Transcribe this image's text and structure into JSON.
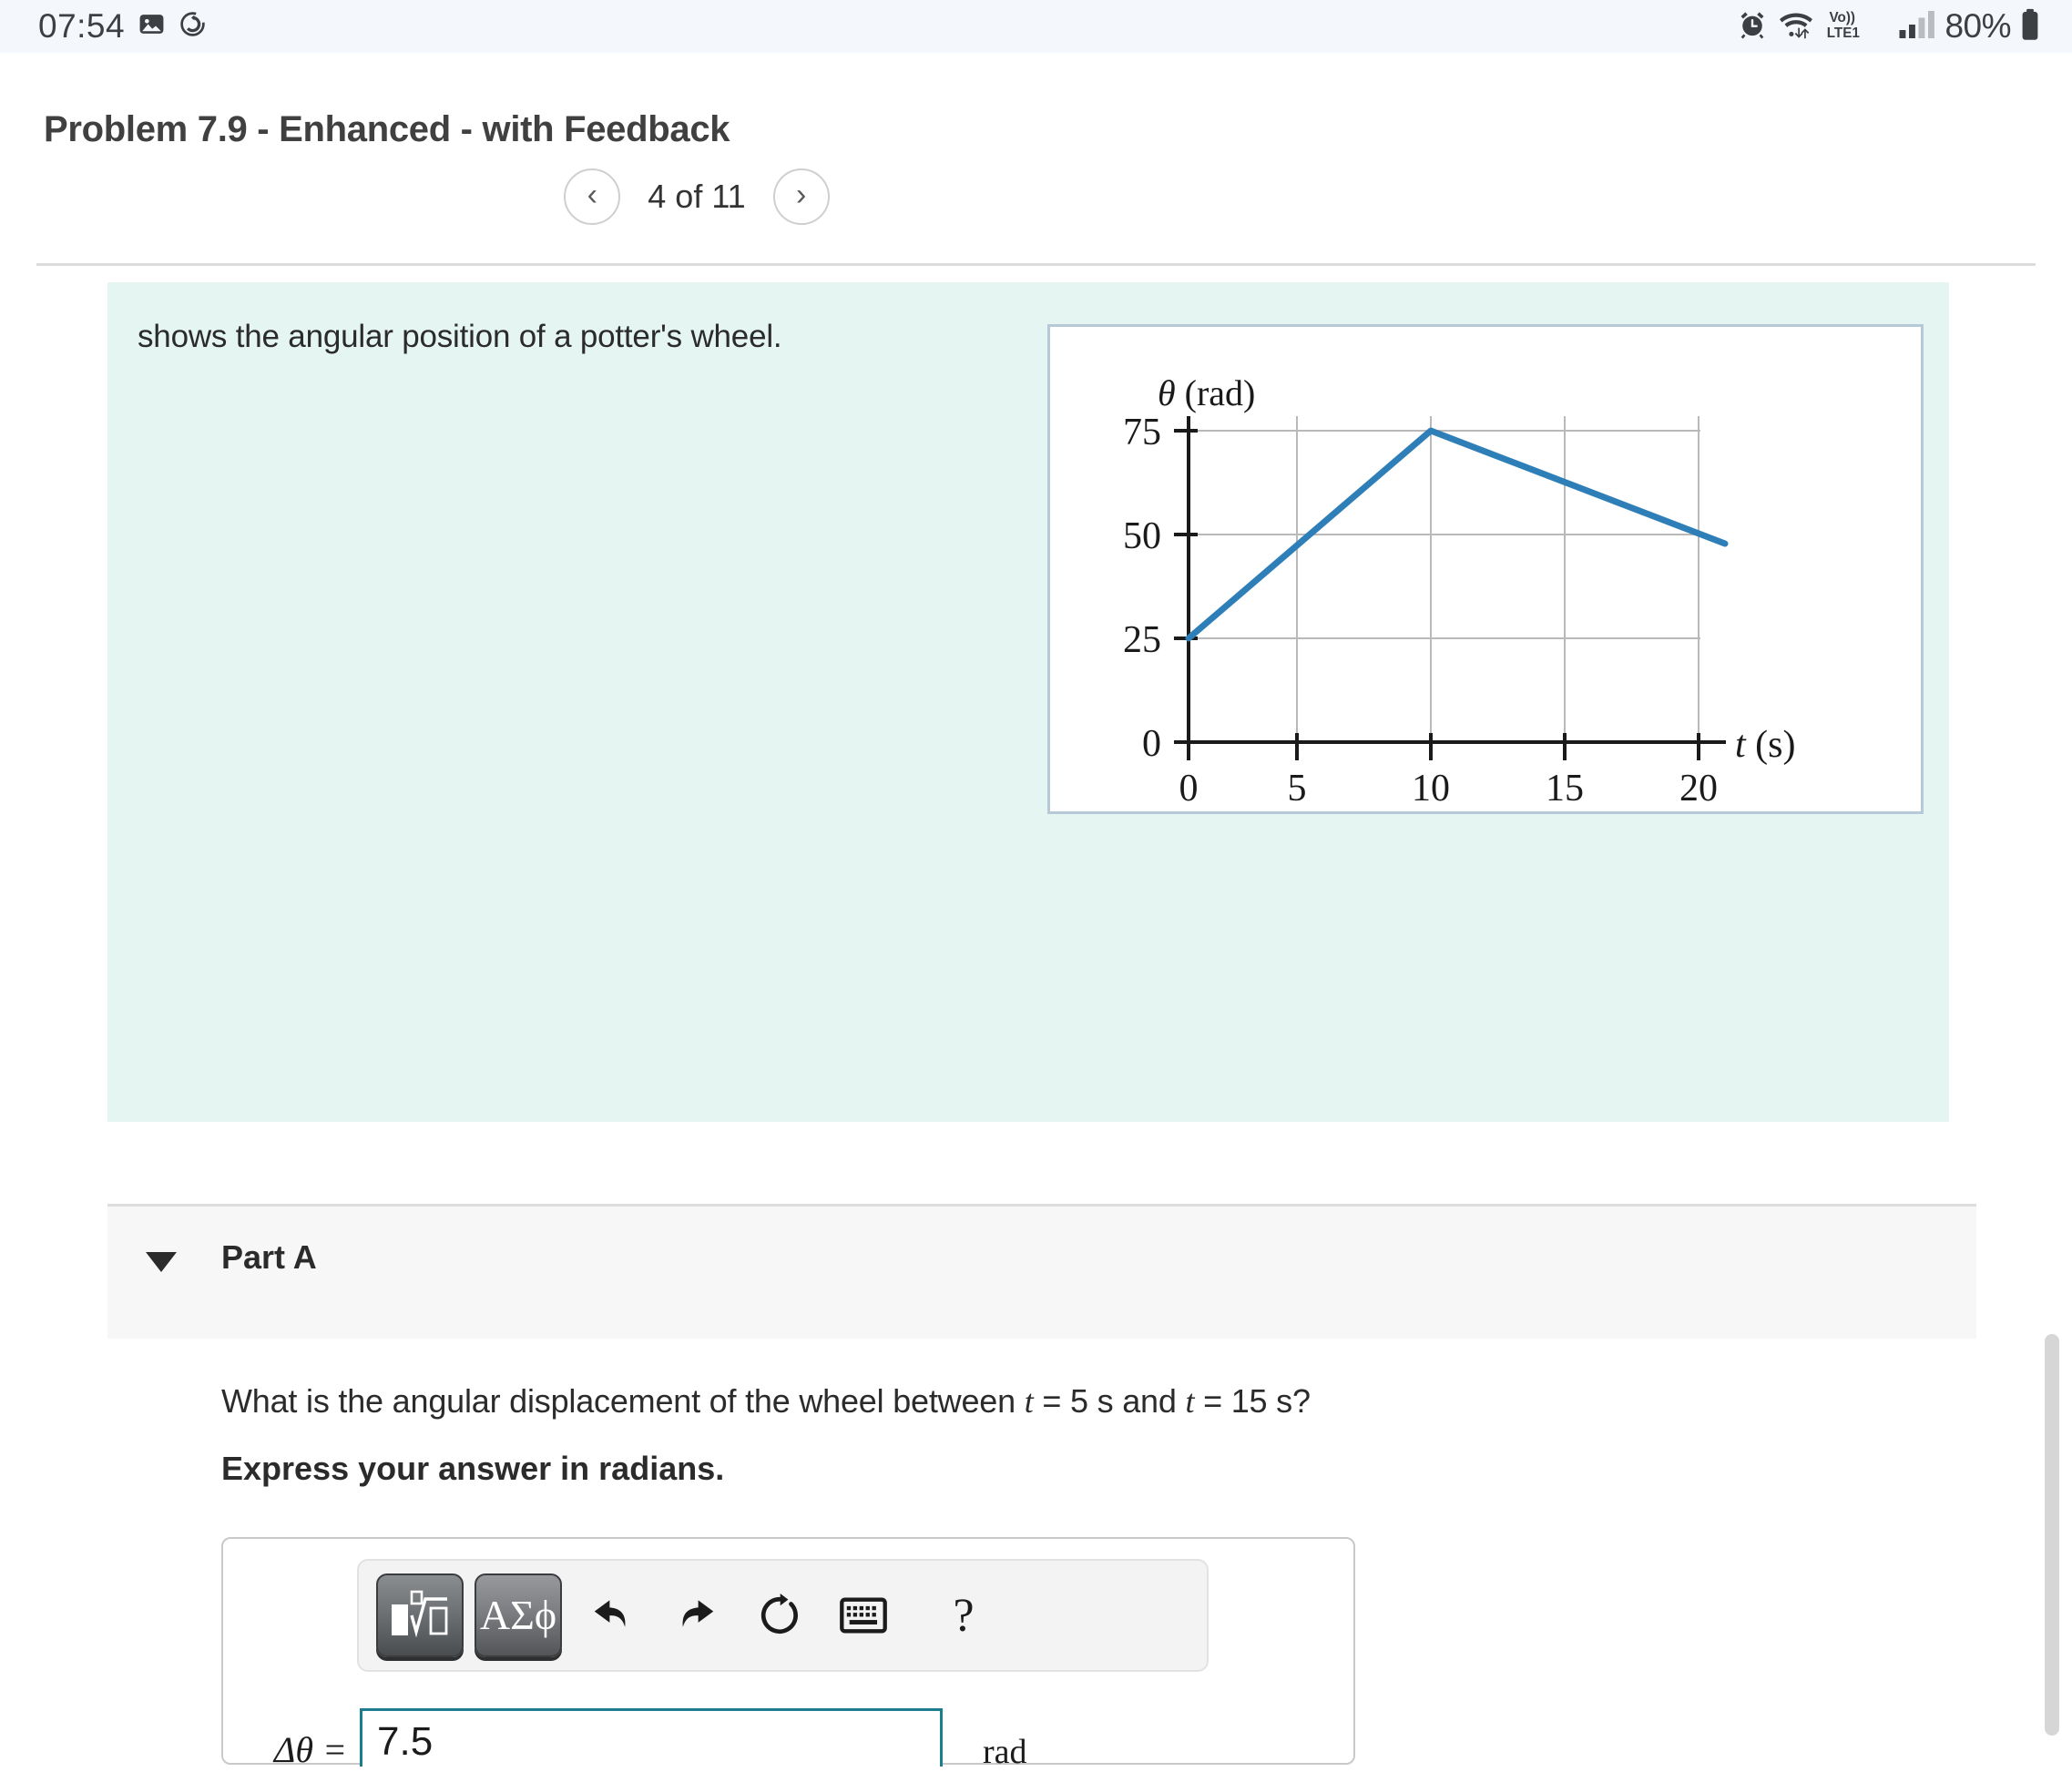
{
  "status_bar": {
    "time": "07:54",
    "battery_percent": "80%",
    "network_label": "LTE1",
    "voice_label": "Vo))",
    "icons": [
      "image-icon",
      "sync-icon",
      "alarm-icon",
      "wifi-icon",
      "signal-icon",
      "battery-icon"
    ]
  },
  "header": {
    "title": "Problem 7.9 - Enhanced - with Feedback",
    "pager": {
      "prev_label": "‹",
      "position_label": "4 of 11",
      "next_label": "›"
    }
  },
  "question": {
    "text": "shows the angular position of a potter's wheel."
  },
  "chart_data": {
    "type": "line",
    "title": "",
    "xlabel": "t (s)",
    "ylabel": "θ (rad)",
    "xlim": [
      0,
      22
    ],
    "ylim": [
      0,
      82
    ],
    "xticks": [
      "0",
      "5",
      "10",
      "15",
      "20"
    ],
    "xtick_values": [
      0,
      5,
      10,
      15,
      20
    ],
    "yticks": [
      "0",
      "25",
      "50",
      "75"
    ],
    "ytick_values": [
      0,
      25,
      50,
      75
    ],
    "grid": true,
    "legend": false,
    "line_color": "#2e7fb8",
    "series": [
      {
        "name": "angular position",
        "x": [
          0,
          10,
          21
        ],
        "y": [
          25,
          75,
          48
        ]
      }
    ]
  },
  "part_a": {
    "label": "Part A",
    "caret": "▼",
    "prompt_prefix": "What is the angular displacement of the wheel between ",
    "prompt_var1": "t",
    "prompt_mid1": " = 5 s and ",
    "prompt_var2": "t",
    "prompt_mid2": " = 15 s?",
    "instruction": "Express your answer in radians."
  },
  "answer": {
    "toolbar": {
      "template_key_label": "√",
      "greek_key_label": "ΑΣϕ",
      "undo_label": "undo-icon",
      "redo_label": "redo-icon",
      "reset_label": "reset-icon",
      "keyboard_label": "keyboard-icon",
      "help_label": "?"
    },
    "variable_label": "Δθ =",
    "value": "7.5",
    "unit": "rad",
    "accent_color": "#1c7d8e"
  }
}
